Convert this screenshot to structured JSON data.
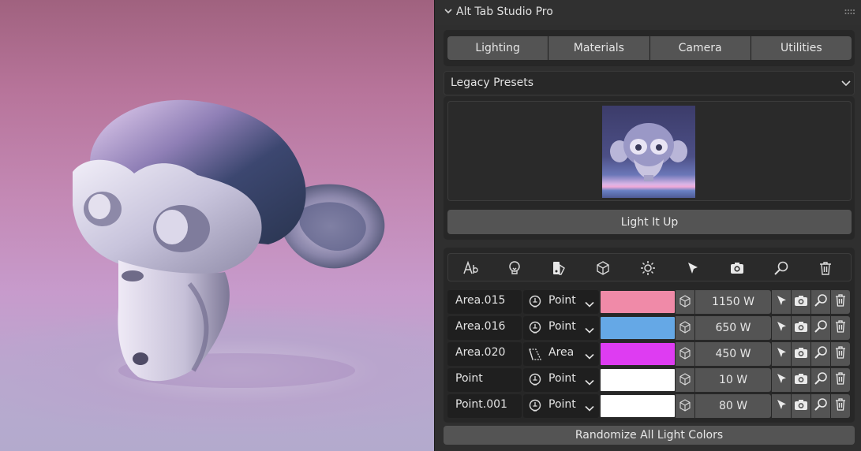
{
  "panel": {
    "title": "Alt Tab Studio Pro",
    "tabs": [
      "Lighting",
      "Materials",
      "Camera",
      "Utilities"
    ],
    "preset_dropdown": "Legacy Presets",
    "main_button": "Light It Up",
    "bottom_button": "Randomize All Light Colors",
    "toolbar_icons": [
      "text-rename-icon",
      "bulb-icon",
      "color-palette-icon",
      "cube-icon",
      "sun-icon",
      "cursor-select-icon",
      "camera-icon",
      "magnifier-icon",
      "trash-icon"
    ]
  },
  "lights": [
    {
      "name": "Area.015",
      "type": "Point",
      "type_icon": "point-light-icon",
      "color": "#f08aa8",
      "power": "1150 W"
    },
    {
      "name": "Area.016",
      "type": "Point",
      "type_icon": "point-light-icon",
      "color": "#65a8e6",
      "power": "650 W"
    },
    {
      "name": "Area.020",
      "type": "Area",
      "type_icon": "area-light-icon",
      "color": "#de3cf2",
      "power": "450 W"
    },
    {
      "name": "Point",
      "type": "Point",
      "type_icon": "point-light-icon",
      "color": "#ffffff",
      "power": "10 W"
    },
    {
      "name": "Point.001",
      "type": "Point",
      "type_icon": "point-light-icon",
      "color": "#ffffff",
      "power": "80 W"
    }
  ]
}
